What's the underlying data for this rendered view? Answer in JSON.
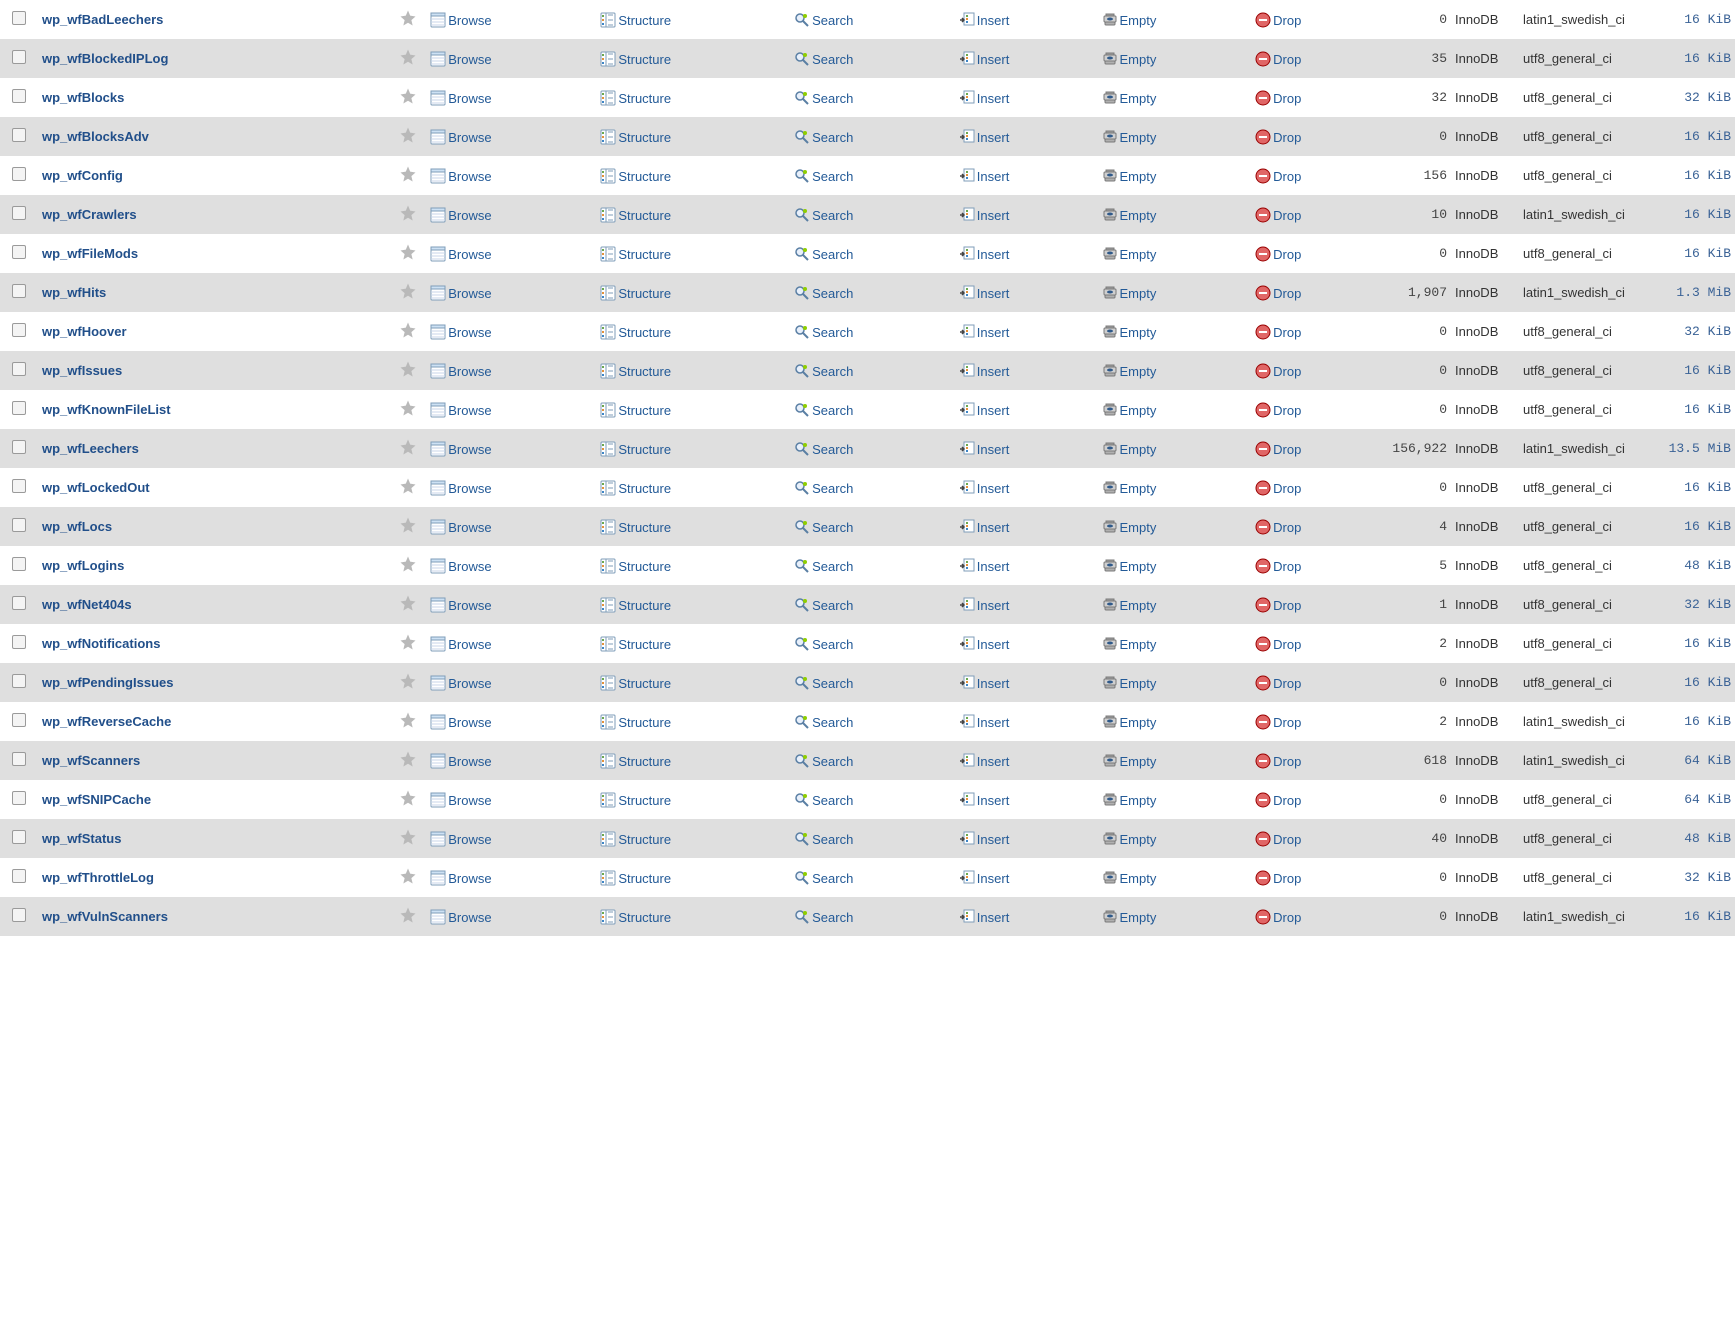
{
  "actions": {
    "browse": "Browse",
    "structure": "Structure",
    "search": "Search",
    "insert": "Insert",
    "empty": "Empty",
    "drop": "Drop"
  },
  "tables": [
    {
      "name": "wp_wfBadLeechers",
      "rows": "0",
      "engine": "InnoDB",
      "collation": "latin1_swedish_ci",
      "size": "16 KiB"
    },
    {
      "name": "wp_wfBlockedIPLog",
      "rows": "35",
      "engine": "InnoDB",
      "collation": "utf8_general_ci",
      "size": "16 KiB"
    },
    {
      "name": "wp_wfBlocks",
      "rows": "32",
      "engine": "InnoDB",
      "collation": "utf8_general_ci",
      "size": "32 KiB"
    },
    {
      "name": "wp_wfBlocksAdv",
      "rows": "0",
      "engine": "InnoDB",
      "collation": "utf8_general_ci",
      "size": "16 KiB"
    },
    {
      "name": "wp_wfConfig",
      "rows": "156",
      "engine": "InnoDB",
      "collation": "utf8_general_ci",
      "size": "16 KiB"
    },
    {
      "name": "wp_wfCrawlers",
      "rows": "10",
      "engine": "InnoDB",
      "collation": "latin1_swedish_ci",
      "size": "16 KiB"
    },
    {
      "name": "wp_wfFileMods",
      "rows": "0",
      "engine": "InnoDB",
      "collation": "utf8_general_ci",
      "size": "16 KiB"
    },
    {
      "name": "wp_wfHits",
      "rows": "1,907",
      "engine": "InnoDB",
      "collation": "latin1_swedish_ci",
      "size": "1.3 MiB"
    },
    {
      "name": "wp_wfHoover",
      "rows": "0",
      "engine": "InnoDB",
      "collation": "utf8_general_ci",
      "size": "32 KiB"
    },
    {
      "name": "wp_wfIssues",
      "rows": "0",
      "engine": "InnoDB",
      "collation": "utf8_general_ci",
      "size": "16 KiB"
    },
    {
      "name": "wp_wfKnownFileList",
      "rows": "0",
      "engine": "InnoDB",
      "collation": "utf8_general_ci",
      "size": "16 KiB"
    },
    {
      "name": "wp_wfLeechers",
      "rows": "156,922",
      "engine": "InnoDB",
      "collation": "latin1_swedish_ci",
      "size": "13.5 MiB"
    },
    {
      "name": "wp_wfLockedOut",
      "rows": "0",
      "engine": "InnoDB",
      "collation": "utf8_general_ci",
      "size": "16 KiB"
    },
    {
      "name": "wp_wfLocs",
      "rows": "4",
      "engine": "InnoDB",
      "collation": "utf8_general_ci",
      "size": "16 KiB"
    },
    {
      "name": "wp_wfLogins",
      "rows": "5",
      "engine": "InnoDB",
      "collation": "utf8_general_ci",
      "size": "48 KiB"
    },
    {
      "name": "wp_wfNet404s",
      "rows": "1",
      "engine": "InnoDB",
      "collation": "utf8_general_ci",
      "size": "32 KiB"
    },
    {
      "name": "wp_wfNotifications",
      "rows": "2",
      "engine": "InnoDB",
      "collation": "utf8_general_ci",
      "size": "16 KiB"
    },
    {
      "name": "wp_wfPendingIssues",
      "rows": "0",
      "engine": "InnoDB",
      "collation": "utf8_general_ci",
      "size": "16 KiB"
    },
    {
      "name": "wp_wfReverseCache",
      "rows": "2",
      "engine": "InnoDB",
      "collation": "latin1_swedish_ci",
      "size": "16 KiB"
    },
    {
      "name": "wp_wfScanners",
      "rows": "618",
      "engine": "InnoDB",
      "collation": "latin1_swedish_ci",
      "size": "64 KiB"
    },
    {
      "name": "wp_wfSNIPCache",
      "rows": "0",
      "engine": "InnoDB",
      "collation": "utf8_general_ci",
      "size": "64 KiB"
    },
    {
      "name": "wp_wfStatus",
      "rows": "40",
      "engine": "InnoDB",
      "collation": "utf8_general_ci",
      "size": "48 KiB"
    },
    {
      "name": "wp_wfThrottleLog",
      "rows": "0",
      "engine": "InnoDB",
      "collation": "utf8_general_ci",
      "size": "32 KiB"
    },
    {
      "name": "wp_wfVulnScanners",
      "rows": "0",
      "engine": "InnoDB",
      "collation": "latin1_swedish_ci",
      "size": "16 KiB"
    }
  ]
}
